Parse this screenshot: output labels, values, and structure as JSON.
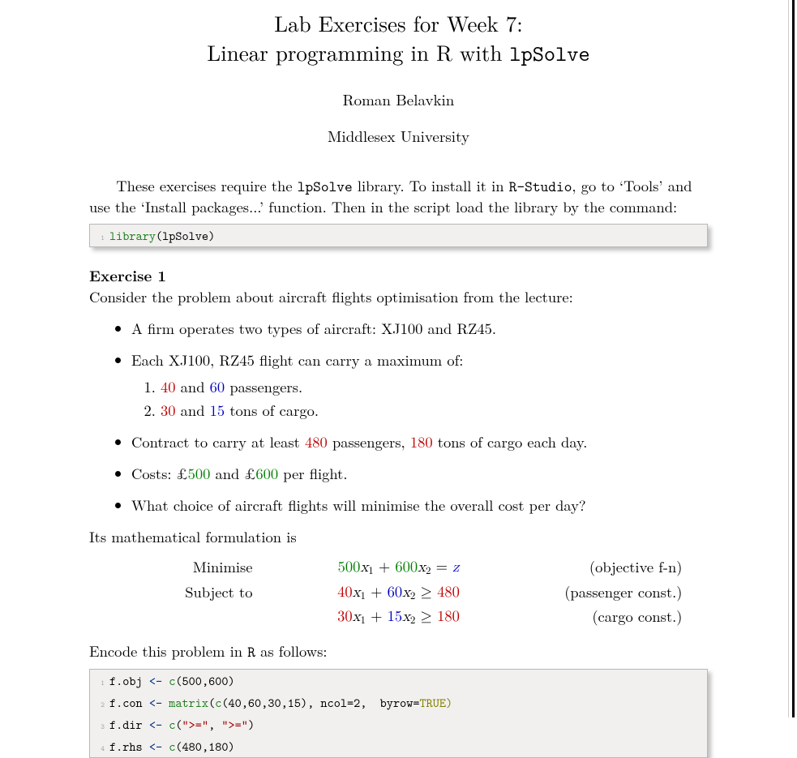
{
  "title_line1": "Lab Exercises for Week 7:",
  "title_line2_pre": "Linear programming in R with ",
  "title_line2_code": "lpSolve",
  "author": "Roman Belavkin",
  "affiliation": "Middlesex University",
  "intro": {
    "pre": "These exercises require the ",
    "lib": "lpSolve",
    "mid": " library. To install it in ",
    "rstudio": "R-Studio",
    "post": ", go to ‘Tools’ and use the ‘Install packages...’ function. Then in the script load the library by the command:"
  },
  "code1": {
    "lineno": "1",
    "t1": "library",
    "t2": "(lpSolve)"
  },
  "ex1_heading": "Exercise 1",
  "ex1_intro": "Consider the problem about aircraft flights optimisation from the lecture:",
  "bullet1": "A firm operates two types of aircraft: XJ100 and RZ45.",
  "bullet2": "Each XJ100, RZ45 flight can carry a maximum of:",
  "enum1": {
    "v1": "40",
    "and": " and ",
    "v2": "60",
    "tail": " passengers."
  },
  "enum2": {
    "v1": "30",
    "and": " and ",
    "v2": "15",
    "tail": " tons of cargo."
  },
  "bullet3": {
    "pre": "Contract to carry at least ",
    "v1": "480",
    "mid": " passengers, ",
    "v2": "180",
    "tail": " tons of cargo each day."
  },
  "bullet4": {
    "pre": "Costs: £",
    "v1": "500",
    "mid": " and £",
    "v2": "600",
    "tail": " per flight."
  },
  "bullet5": "What choice of aircraft flights will minimise the overall cost per day?",
  "formulation_lead": "Its mathematical formulation is",
  "math": {
    "row1": {
      "label": "Minimise",
      "c1": "500",
      "c2": "600",
      "rhs": "z",
      "note": "(objective f-n)"
    },
    "row2": {
      "label": "Subject to",
      "c1": "40",
      "c2": "60",
      "rhs": "480",
      "note": "(passenger const.)"
    },
    "row3": {
      "label": "",
      "c1": "30",
      "c2": "15",
      "rhs": "180",
      "note": "(cargo const.)"
    }
  },
  "encode_lead_pre": "Encode this problem in ",
  "encode_lead_R": "R",
  "encode_lead_post": " as follows:",
  "code2": {
    "l1": {
      "n": "1",
      "a": "f.obj ",
      "b": "<-",
      "c": " c",
      "d": "(500,600)"
    },
    "l2": {
      "n": "2",
      "a": "f.con ",
      "b": "<-",
      "c": " matrix",
      "d": "(",
      "e": "c",
      "f": "(40,60,30,15), ncol",
      "g": "=2,  byrow=",
      "h": "TRUE)"
    },
    "l3": {
      "n": "3",
      "a": "f.dir ",
      "b": "<-",
      "c": " c",
      "d": "(",
      "s1": "\">=\"",
      "comma": ", ",
      "s2": "\">=\"",
      "e": ")"
    },
    "l4": {
      "n": "4",
      "a": "f.rhs ",
      "b": "<-",
      "c": " c",
      "d": "(480,180)"
    }
  }
}
